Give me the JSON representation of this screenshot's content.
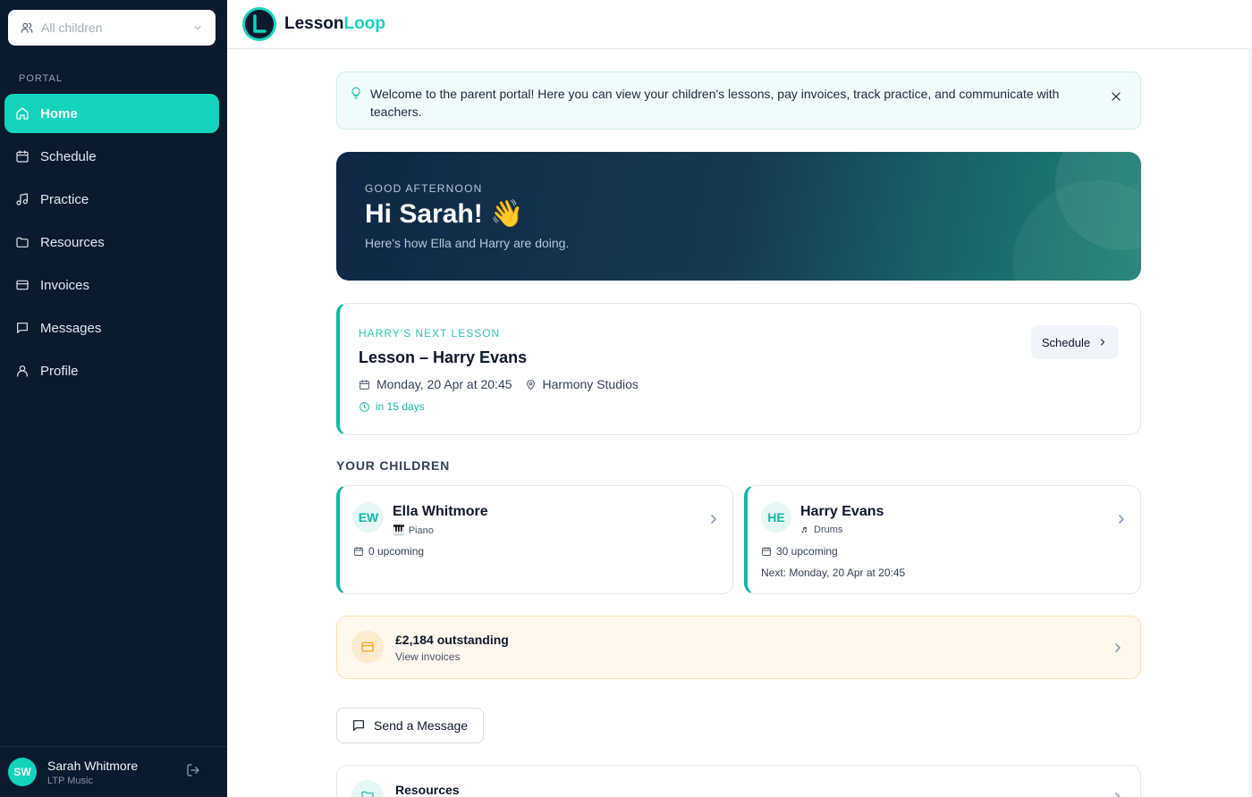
{
  "child_selector": {
    "label": "All children",
    "icon": "users-icon"
  },
  "sidebar": {
    "section_label": "PORTAL",
    "items": [
      {
        "label": "Home",
        "icon": "home-icon",
        "active": true
      },
      {
        "label": "Schedule",
        "icon": "calendar-icon",
        "active": false
      },
      {
        "label": "Practice",
        "icon": "music-note-icon",
        "active": false
      },
      {
        "label": "Resources",
        "icon": "folder-icon",
        "active": false
      },
      {
        "label": "Invoices",
        "icon": "credit-card-icon",
        "active": false
      },
      {
        "label": "Messages",
        "icon": "message-icon",
        "active": false
      },
      {
        "label": "Profile",
        "icon": "user-icon",
        "active": false
      }
    ],
    "user": {
      "initials": "SW",
      "name": "Sarah Whitmore",
      "org": "LTP Music"
    }
  },
  "header": {
    "brand_main": "Lesson",
    "brand_accent": "Loop"
  },
  "welcome": {
    "text": "Welcome to the parent portal! Here you can view your children's lessons, pay invoices, track practice, and communicate with teachers."
  },
  "hero": {
    "greeting": "GOOD AFTERNOON",
    "title": "Hi Sarah! 👋",
    "subtitle": "Here's how Ella and Harry are doing."
  },
  "next_lesson": {
    "label": "HARRY'S NEXT LESSON",
    "title": "Lesson – Harry Evans",
    "datetime": "Monday, 20 Apr at 20:45",
    "location": "Harmony Studios",
    "countdown": "in 15 days",
    "button_label": "Schedule"
  },
  "children": {
    "section_title": "YOUR CHILDREN",
    "items": [
      {
        "initials": "EW",
        "name": "Ella Whitmore",
        "instrument_glyph": "🎹",
        "instrument": "Piano",
        "upcoming": "0 upcoming",
        "next": ""
      },
      {
        "initials": "HE",
        "name": "Harry Evans",
        "instrument_glyph": "♬",
        "instrument": "Drums",
        "upcoming": "30 upcoming",
        "next": "Next: Monday, 20 Apr at 20:45"
      }
    ]
  },
  "outstanding": {
    "amount": "£2,184 outstanding",
    "link": "View invoices"
  },
  "message_button": {
    "label": "Send a Message"
  },
  "resources_card": {
    "title": "Resources"
  },
  "colors": {
    "accent": "#14d3bd",
    "sidebar_bg": "#0c1a2e",
    "warning": "#f59e0b"
  }
}
